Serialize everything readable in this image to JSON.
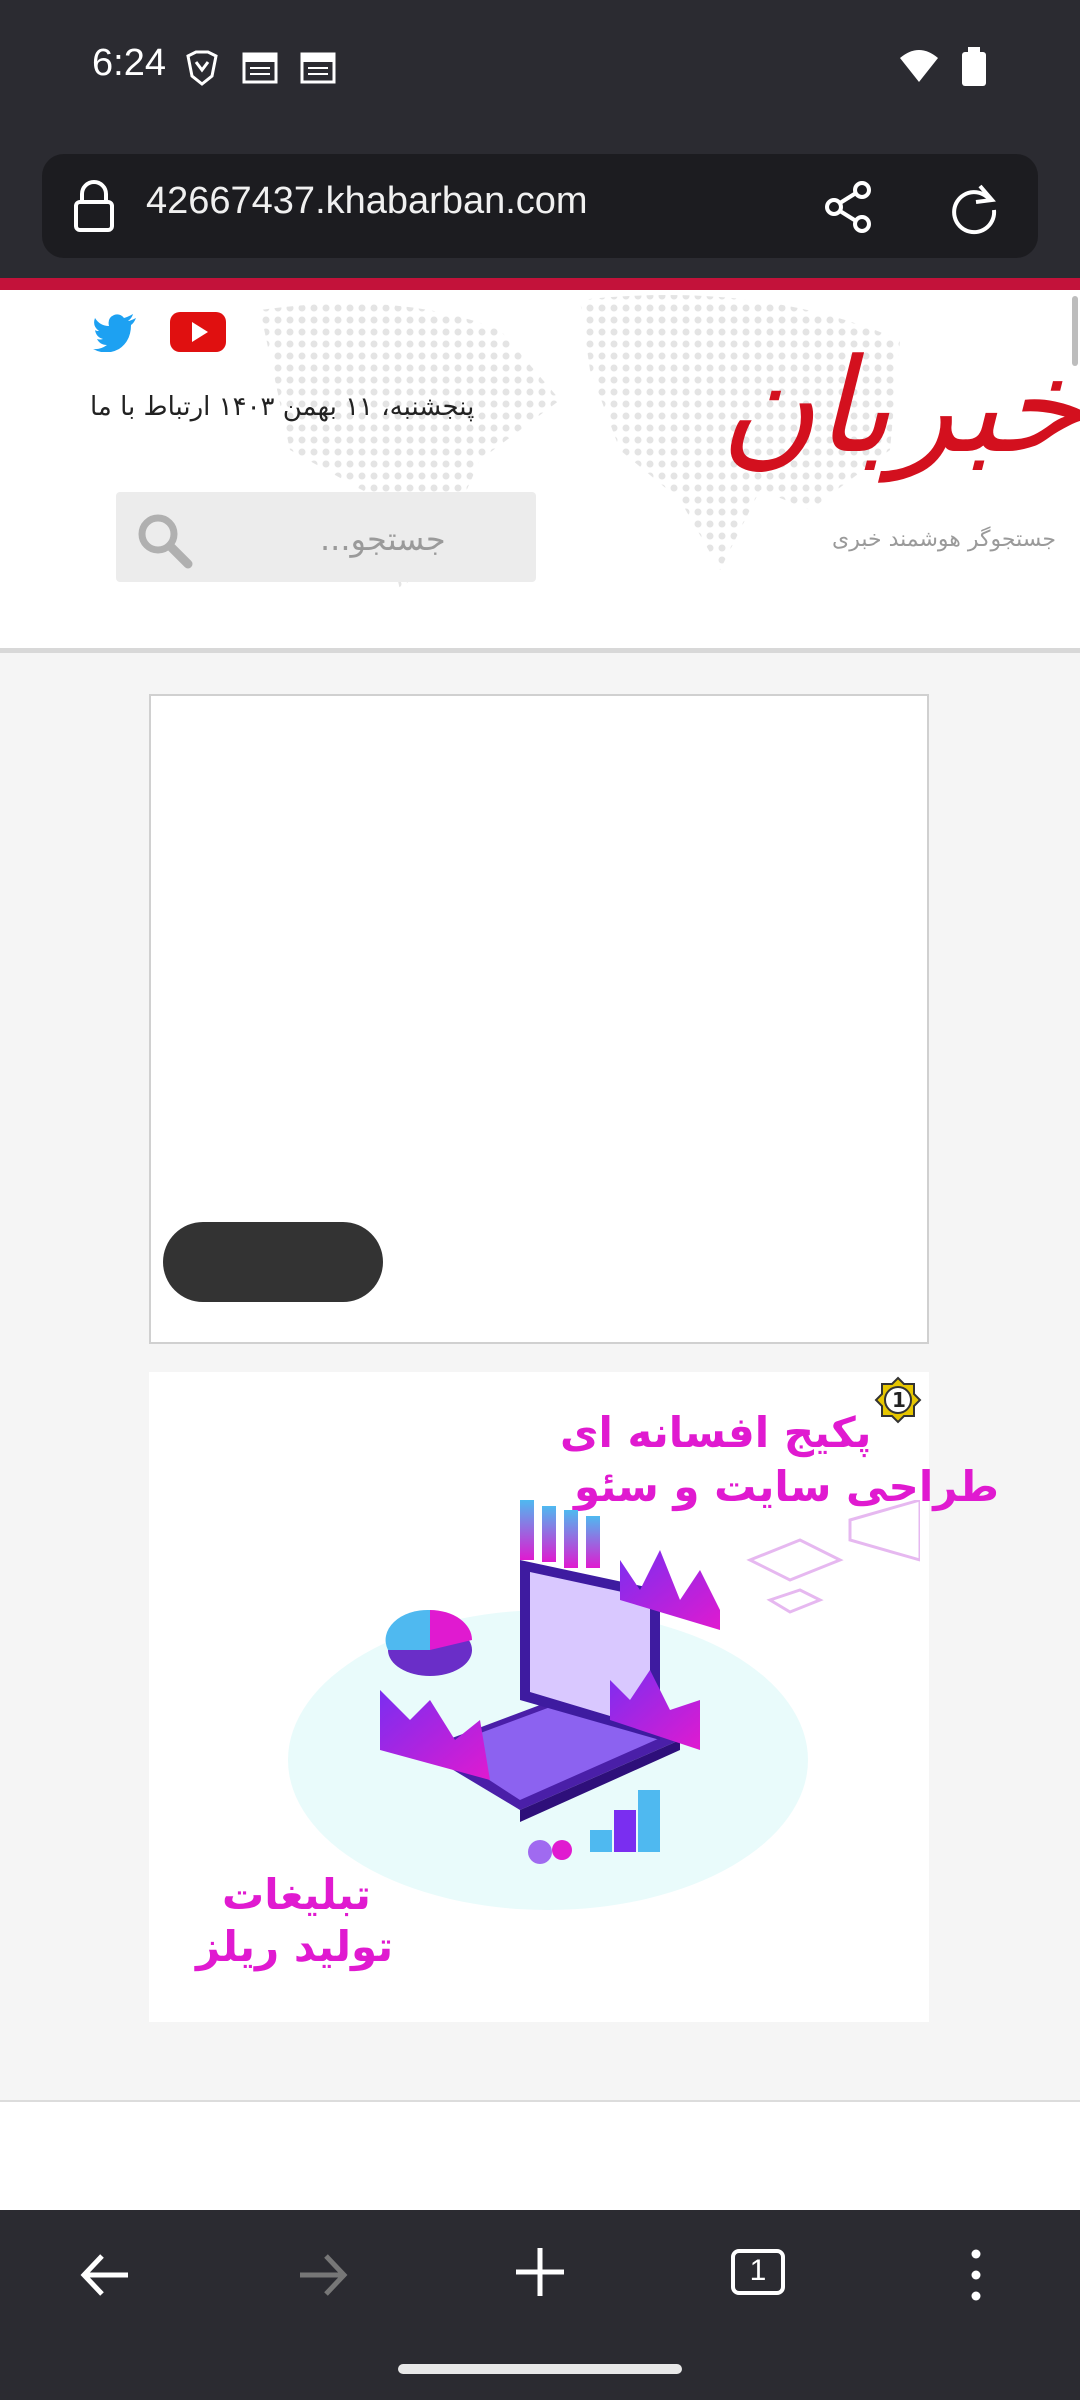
{
  "status_bar": {
    "time": "6:24",
    "icons": [
      "brave-icon",
      "calendar-icon",
      "calendar-icon",
      "wifi-icon",
      "battery-icon"
    ]
  },
  "browser": {
    "url": "42667437.khabarban.com",
    "share_icon": "share-icon",
    "reload_icon": "reload-icon",
    "lock_icon": "lock-icon"
  },
  "site": {
    "logo_text": "خبربان",
    "logo_sub": "جستجوگر هوشمند خبری",
    "date_contact": "پنجشنبه، ۱۱ بهمن ۱۴۰۳ ارتباط با ما",
    "search_placeholder": "جستجو...",
    "social_icons": [
      "twitter-icon",
      "youtube-icon"
    ]
  },
  "ads": {
    "ad2_badge": "1",
    "ad2_title_line1": "پکیج افسانه ای",
    "ad2_title_line2": "طراحی سایت و سئو",
    "ad2_bottom_line1": "تبلیغات",
    "ad2_bottom_line2": "تولید ریلز"
  },
  "bottom_nav": {
    "tab_count": "1",
    "icons": [
      "back-icon",
      "forward-icon",
      "new-tab-icon",
      "tabs-icon",
      "menu-icon"
    ]
  },
  "colors": {
    "chrome_bg": "#2b2b31",
    "brand_red": "#c3123a",
    "ad_magenta": "#e01ad0"
  }
}
